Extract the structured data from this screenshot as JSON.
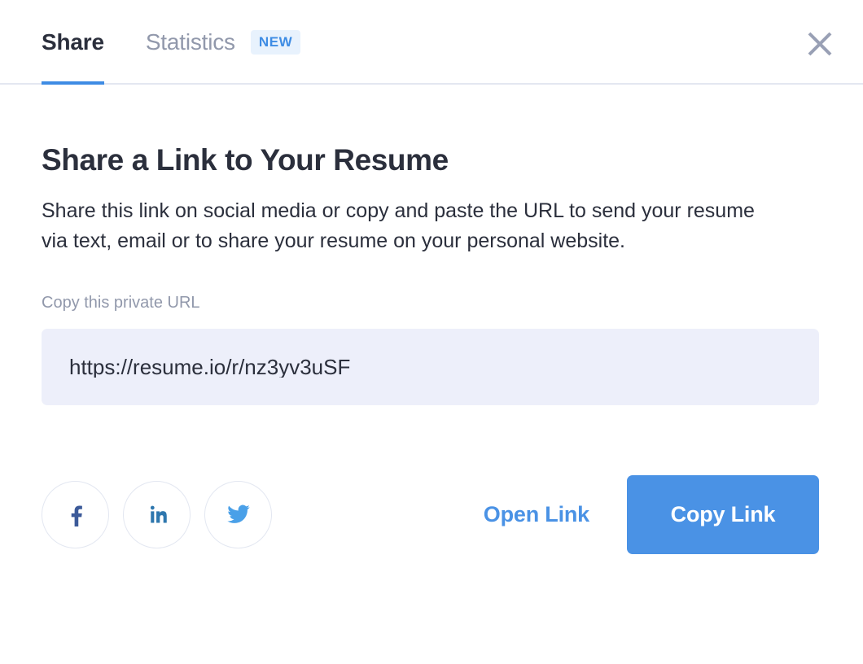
{
  "dialog": {
    "tabs": [
      {
        "label": "Share",
        "active": true,
        "badge": null
      },
      {
        "label": "Statistics",
        "active": false,
        "badge": "NEW"
      }
    ],
    "close_icon": "close-icon",
    "headline": "Share a Link to Your Resume",
    "description": "Share this link on social media or copy and paste the URL to send your resume via text, email or to share your resume on your personal website.",
    "url_field": {
      "label": "Copy this private URL",
      "value": "https://resume.io/r/nz3yv3uSF",
      "placeholder": "https://resume.io/r/"
    },
    "social_buttons": [
      {
        "name": "facebook-icon",
        "label": "Facebook",
        "color": "#3c5a99"
      },
      {
        "name": "linkedin-icon",
        "label": "LinkedIn",
        "color": "#2e77ae"
      },
      {
        "name": "twitter-icon",
        "label": "Twitter",
        "color": "#4aa0e8"
      }
    ],
    "open_link_label": "Open Link",
    "copy_link_label": "Copy Link"
  },
  "colors": {
    "accent": "#4a92e5",
    "tab_active_underline": "#3e8ce4",
    "badge_bg": "#e8f2fd",
    "badge_text": "#3e8ce4",
    "text_dark": "#2b2f3c",
    "text_muted": "#9198ab",
    "field_bg": "#edeffa",
    "divider": "#e3e7f1"
  }
}
